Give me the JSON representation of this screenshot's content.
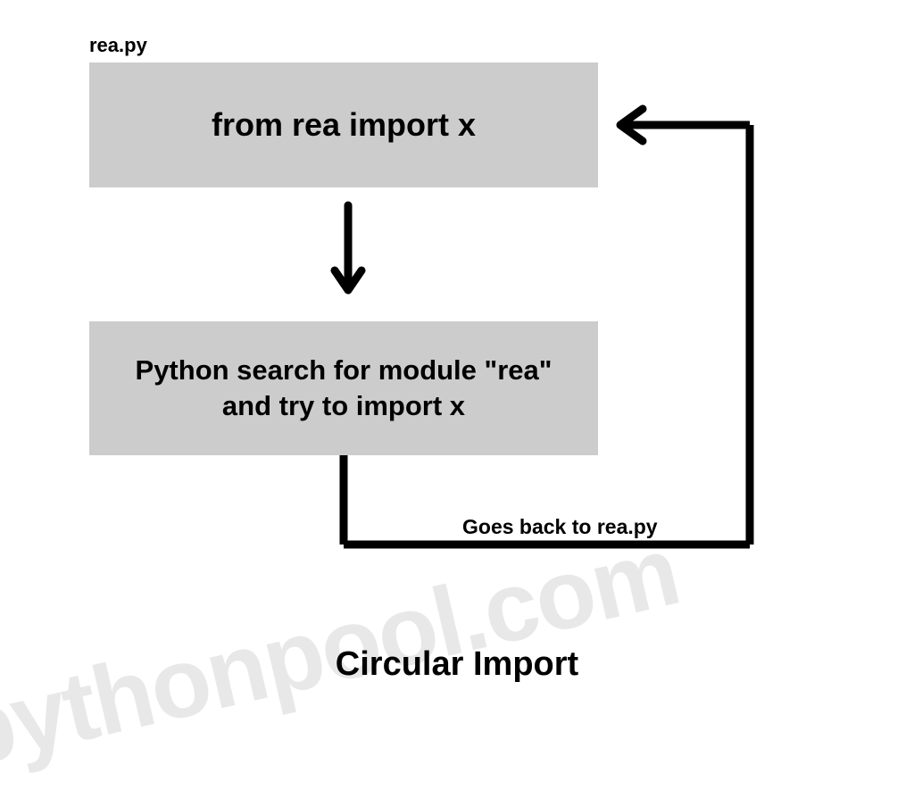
{
  "filename": "rea.py",
  "box1_text": "from rea import x",
  "box2_text": "Python search for module \"rea\" and try to import x",
  "loop_label": "Goes back to rea.py",
  "title": "Circular Import",
  "watermark": "pythonpool.com"
}
